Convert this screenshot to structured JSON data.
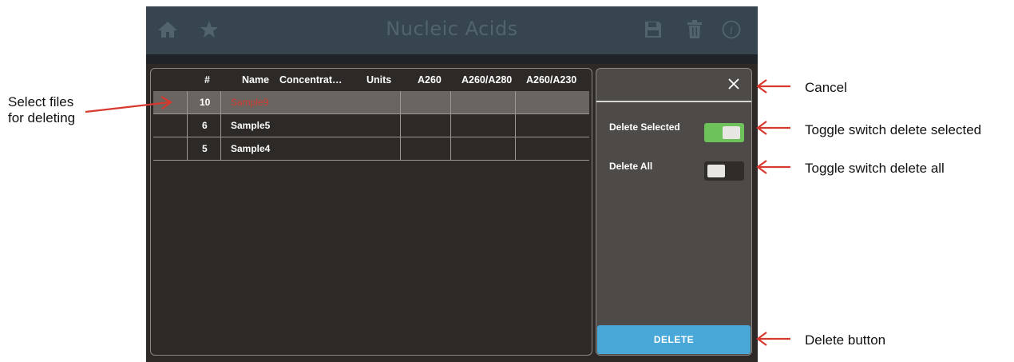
{
  "app": {
    "title": "Nucleic Acids",
    "icons": [
      "home-icon",
      "star-icon",
      "save-icon",
      "trash-icon",
      "info-icon"
    ],
    "header_color": "#37454f",
    "title_color": "#52636e"
  },
  "table": {
    "headers": [
      "#",
      "Name",
      "Concentrat…",
      "Units",
      "A260",
      "A260/A280",
      "A260/A230"
    ],
    "rows": [
      {
        "num": "10",
        "name": "Sample9",
        "selected": true
      },
      {
        "num": "6",
        "name": "Sample5",
        "selected": false
      },
      {
        "num": "5",
        "name": "Sample4",
        "selected": false
      }
    ]
  },
  "side_panel": {
    "delete_selected_label": "Delete Selected",
    "delete_selected_on": true,
    "delete_all_label": "Delete All",
    "delete_all_on": false,
    "delete_button": "DELETE",
    "accent_green": "#6ec25a",
    "accent_blue": "#4aa8d8"
  },
  "annotations": {
    "select_files": "Select files\nfor deleting",
    "select_files_l1": "Select files",
    "select_files_l2": "for deleting",
    "cancel": "Cancel",
    "toggle_selected": "Toggle switch delete selected",
    "toggle_all": "Toggle switch delete all",
    "delete_button": "Delete button",
    "arrow_color": "#d8392f"
  }
}
